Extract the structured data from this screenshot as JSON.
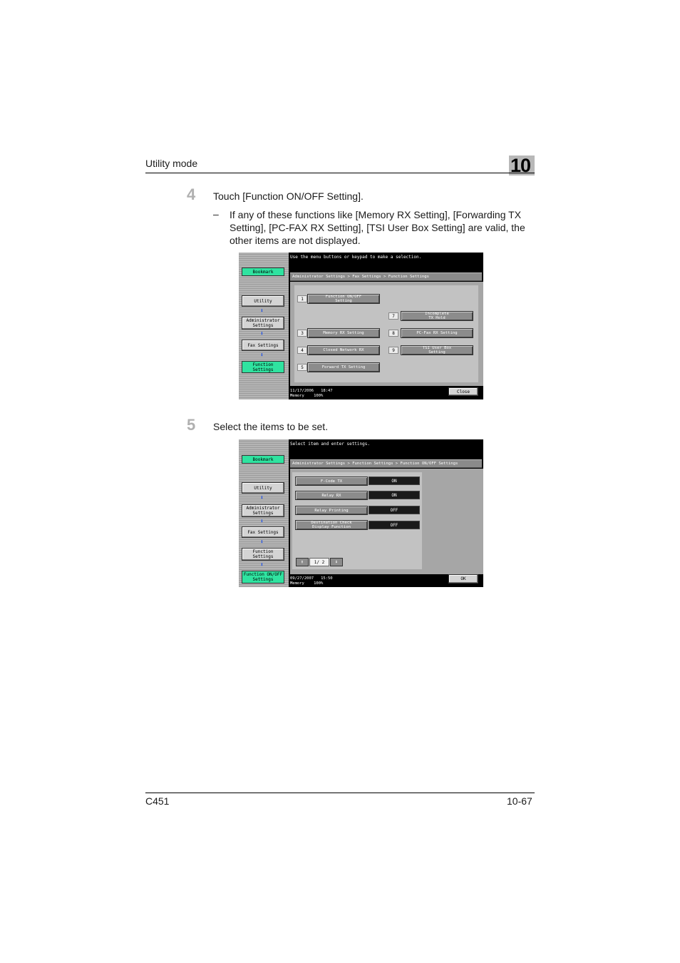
{
  "header": {
    "section": "Utility mode",
    "chapter": "10"
  },
  "step4": {
    "number": "4",
    "instruction": "Touch [Function ON/OFF Setting].",
    "note_dash": "–",
    "note_line1": "If any of these functions like [Memory RX Setting], [Forwarding TX",
    "note_line2": "Setting], [PC-FAX RX Setting], [TSI User Box Setting] are valid, the",
    "note_line3": "other items are not displayed."
  },
  "screen1": {
    "top_message": "Use the menu buttons or keypad to make a selection.",
    "breadcrumb": "Administrator Settings > Fax Settings > Function Settings",
    "sidebar": {
      "bookmark": "Bookmark",
      "utility": "Utility",
      "admin_line1": "Administrator",
      "admin_line2": "Settings",
      "fax": "Fax Settings",
      "func_line1": "Function",
      "func_line2": "Settings"
    },
    "arrow_glyph": "⬇",
    "items": [
      {
        "num": "1",
        "label_line1": "Function ON/OFF",
        "label_line2": "Setting"
      },
      {
        "num": "3",
        "label_line1": "Memory RX Setting",
        "label_line2": ""
      },
      {
        "num": "4",
        "label_line1": "Closed Network RX",
        "label_line2": ""
      },
      {
        "num": "5",
        "label_line1": "Forward TX Setting",
        "label_line2": ""
      },
      {
        "num": "7",
        "label_line1": "Incomplete",
        "label_line2": "TX Hold"
      },
      {
        "num": "8",
        "label_line1": "PC-Fax RX Setting",
        "label_line2": ""
      },
      {
        "num": "9",
        "label_line1": "TSI User Box",
        "label_line2": "Setting"
      }
    ],
    "date": "11/17/2006",
    "time": "18:47",
    "memory_label": "Memory",
    "memory_value": "100%",
    "close_button": "Close"
  },
  "step5": {
    "number": "5",
    "instruction": "Select the items to be set."
  },
  "screen2": {
    "top_message": "Select item and enter settings.",
    "breadcrumb": "Administrator Settings > Function Settings > Function ON/OFF Settings",
    "sidebar": {
      "bookmark": "Bookmark",
      "utility": "Utility",
      "admin_line1": "Administrator",
      "admin_line2": "Settings",
      "fax": "Fax Settings",
      "func_line1": "Function",
      "func_line2": "Settings",
      "onoff_line1": "Function ON/OFF",
      "onoff_line2": "Settings"
    },
    "arrow_glyph": "⬇",
    "rows": [
      {
        "label_line1": "F-Code TX",
        "label_line2": "",
        "value": "ON"
      },
      {
        "label_line1": "Relay RX",
        "label_line2": "",
        "value": "ON"
      },
      {
        "label_line1": "Relay Printing",
        "label_line2": "",
        "value": "OFF"
      },
      {
        "label_line1": "Destination Check",
        "label_line2": "Display Function",
        "value": "OFF"
      }
    ],
    "page_up": "⬆",
    "page_down": "⬇",
    "page_indicator": "1/ 2",
    "date": "09/27/2007",
    "time": "15:50",
    "memory_label": "Memory",
    "memory_value": "100%",
    "ok_button": "OK"
  },
  "footer": {
    "model": "C451",
    "page": "10-67"
  }
}
